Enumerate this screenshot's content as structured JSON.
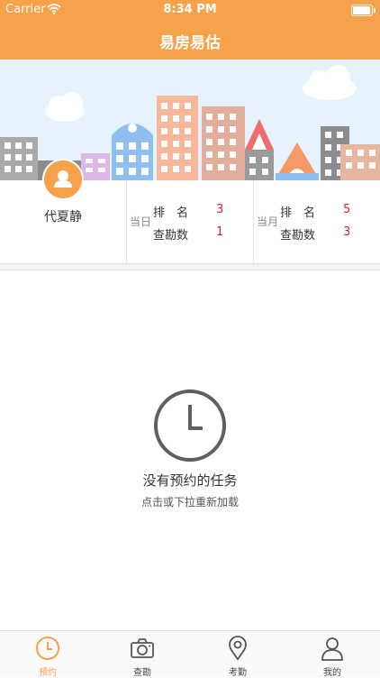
{
  "status_bar": {
    "carrier": "Carrier",
    "time": "8:34 PM"
  },
  "nav": {
    "title": "易房易估"
  },
  "user": {
    "name": "代夏静"
  },
  "stats": {
    "today": {
      "period": "当日",
      "rank_label": "排　名",
      "rank": "3",
      "survey_label": "查勘数",
      "survey": "1"
    },
    "month": {
      "period": "当月",
      "rank_label": "排　名",
      "rank": "5",
      "survey_label": "查勘数",
      "survey": "3"
    }
  },
  "empty_state": {
    "title": "没有预约的任务",
    "subtitle": "点击或下拉重新加载"
  },
  "tabs": [
    {
      "label": "预约",
      "icon": "clock-icon",
      "active": true
    },
    {
      "label": "查勘",
      "icon": "camera-icon",
      "active": false
    },
    {
      "label": "考勤",
      "icon": "location-pin-icon",
      "active": false
    },
    {
      "label": "我的",
      "icon": "person-icon",
      "active": false
    }
  ],
  "colors": {
    "accent": "#f6a24b",
    "value_red": "#e02020",
    "banner_sky": "#e6f2fd"
  }
}
